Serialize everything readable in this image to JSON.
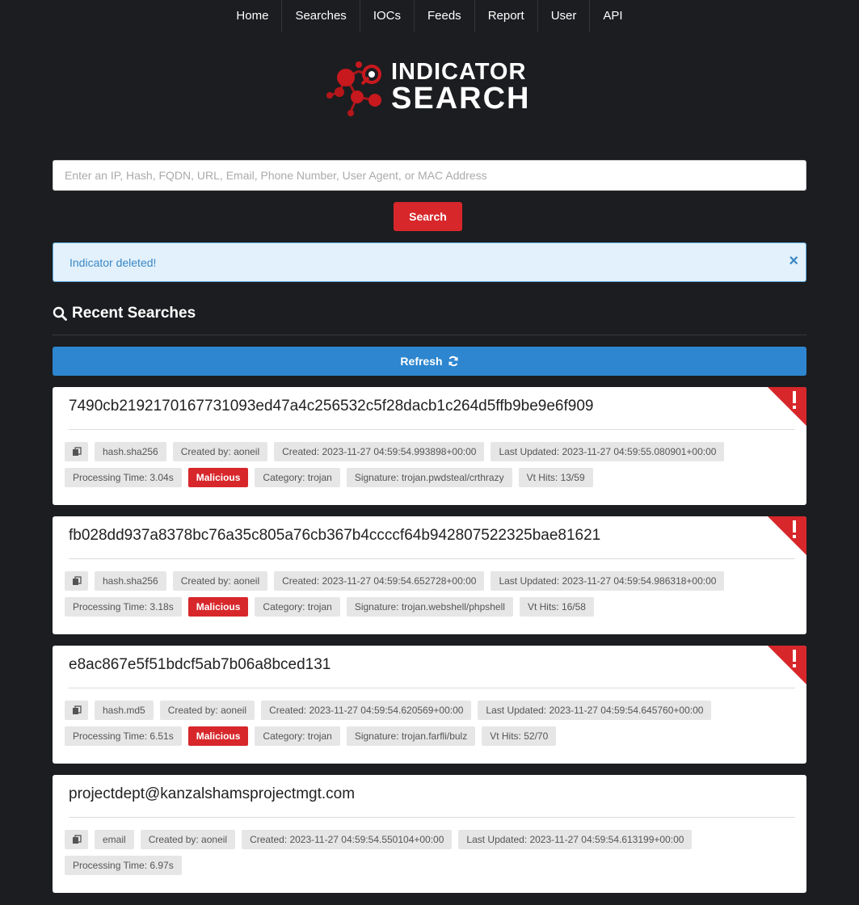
{
  "nav": {
    "items": [
      "Home",
      "Searches",
      "IOCs",
      "Feeds",
      "Report",
      "User",
      "API"
    ]
  },
  "logo": {
    "line1": "INDICATOR",
    "line2": "SEARCH"
  },
  "search": {
    "placeholder": "Enter an IP, Hash, FQDN, URL, Email, Phone Number, User Agent, or MAC Address",
    "button_label": "Search"
  },
  "alert": {
    "message": "Indicator deleted!",
    "close": "×"
  },
  "recent": {
    "title": "Recent Searches",
    "refresh_label": "Refresh"
  },
  "colors": {
    "background": "#1c1d20",
    "accent_red": "#d7272b",
    "accent_blue": "#2d86cf",
    "alert_bg": "#e2f1fc"
  },
  "results": [
    {
      "indicator": "7490cb219217016773109 3ed47a4c256532c5f28dacb1c264d5ffb9be9e6f909",
      "type": "hash.sha256",
      "created_by": "Created by: aoneil",
      "created": "Created: 2023-11-27 04:59:54.993898+00:00",
      "last_updated": "Last Updated: 2023-11-27 04:59:55.080901+00:00",
      "processing_time": "Processing Time: 3.04s",
      "verdict": "Malicious",
      "category": "Category: trojan",
      "signature": "Signature: trojan.pwdsteal/crthrazy",
      "vt_hits": "Vt Hits: 13/59"
    },
    {
      "indicator": "fb028dd937a8378bc76a35c805a76cb367b4ccccf64b942807522325bae81621",
      "type": "hash.sha256",
      "created_by": "Created by: aoneil",
      "created": "Created: 2023-11-27 04:59:54.652728+00:00",
      "last_updated": "Last Updated: 2023-11-27 04:59:54.986318+00:00",
      "processing_time": "Processing Time: 3.18s",
      "verdict": "Malicious",
      "category": "Category: trojan",
      "signature": "Signature: trojan.webshell/phpshell",
      "vt_hits": "Vt Hits: 16/58"
    },
    {
      "indicator": "e8ac867e5f51bdcf5ab7b06a8bced131",
      "type": "hash.md5",
      "created_by": "Created by: aoneil",
      "created": "Created: 2023-11-27 04:59:54.620569+00:00",
      "last_updated": "Last Updated: 2023-11-27 04:59:54.645760+00:00",
      "processing_time": "Processing Time: 6.51s",
      "verdict": "Malicious",
      "category": "Category: trojan",
      "signature": "Signature: trojan.farfli/bulz",
      "vt_hits": "Vt Hits: 52/70"
    },
    {
      "indicator": "projectdept@kanzalshamsprojectmgt.com",
      "type": "email",
      "created_by": "Created by: aoneil",
      "created": "Created: 2023-11-27 04:59:54.550104+00:00",
      "last_updated": "Last Updated: 2023-11-27 04:59:54.613199+00:00",
      "processing_time": "Processing Time: 6.97s"
    }
  ],
  "icons": {
    "search": "search-icon",
    "refresh": "refresh-icon",
    "copy": "copy-icon",
    "alert_ribbon": "exclamation-icon"
  }
}
